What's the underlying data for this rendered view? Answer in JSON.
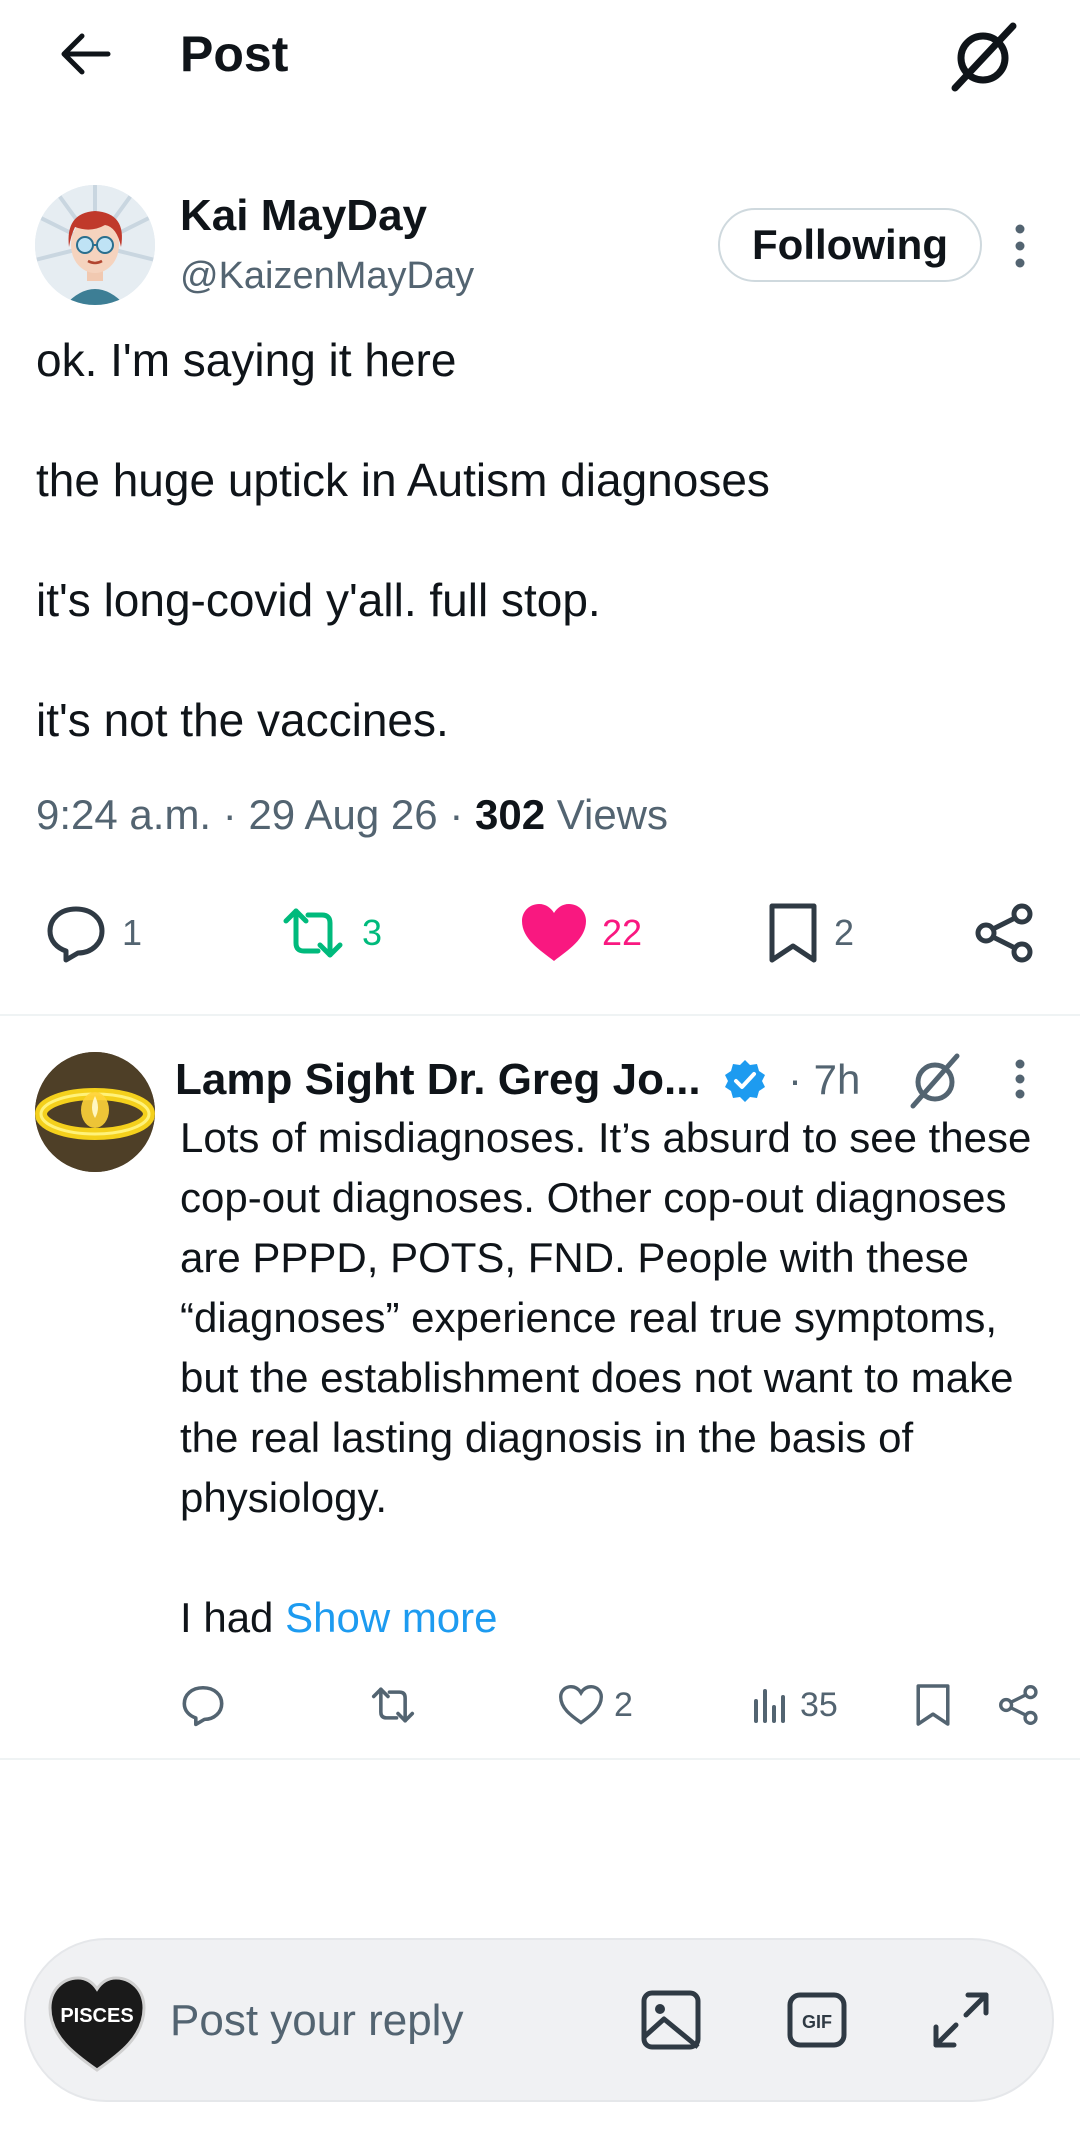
{
  "header": {
    "title": "Post",
    "icons": {
      "back": "back-arrow-icon",
      "grok": "grok-icon"
    }
  },
  "post": {
    "author_name": "Kai MayDay",
    "author_handle": "@KaizenMayDay",
    "follow_label": "Following",
    "text": [
      "ok. I'm saying it here",
      "the huge uptick in Autism diagnoses",
      "it's long-covid y'all. full stop.",
      "it's not the vaccines."
    ],
    "time": "9:24 a.m.",
    "sep1": "·",
    "date": "29 Aug 26",
    "sep2": "·",
    "views_count": "302",
    "views_label": "Views",
    "actions": {
      "replies": "1",
      "reposts": "3",
      "likes": "22",
      "bookmarks": "2"
    },
    "colors": {
      "repost": "#00ba7c",
      "like": "#f91880",
      "like_text": "#f91880"
    }
  },
  "reply": {
    "author_name": "Lamp Sight Dr. Greg Jo...",
    "time": "· 7h",
    "text": "Lots of misdiagnoses. It’s absurd to see these cop-out diagnoses. Other cop-out diagnoses are PPPD, POTS, FND. People with these “diagnoses” experience real true symptoms, but the establishment does not want to make the real lasting diagnosis in the basis of physiology.",
    "text_tail": "I had ",
    "show_more": "Show more",
    "actions": {
      "likes": "2",
      "views": "35"
    },
    "colors": {
      "verified": "#1d9bf0",
      "link": "#1d9bf0"
    }
  },
  "composer": {
    "avatar_text": "PISCES",
    "placeholder": "Post your reply",
    "icons": [
      "image-icon",
      "gif-icon",
      "expand-icon"
    ],
    "gif_label": "GIF"
  }
}
